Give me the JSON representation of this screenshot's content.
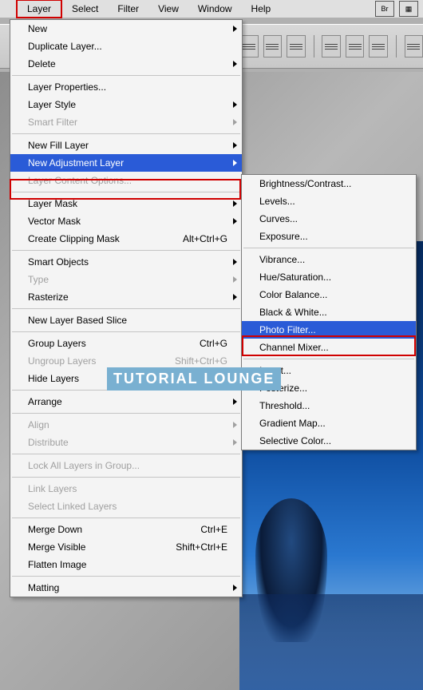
{
  "menubar": {
    "items": [
      "Layer",
      "Select",
      "Filter",
      "View",
      "Window",
      "Help"
    ]
  },
  "menu1": [
    {
      "label": "New",
      "arrow": true
    },
    {
      "label": "Duplicate Layer..."
    },
    {
      "label": "Delete",
      "arrow": true
    },
    {
      "sep": true
    },
    {
      "label": "Layer Properties..."
    },
    {
      "label": "Layer Style",
      "arrow": true
    },
    {
      "label": "Smart Filter",
      "arrow": true,
      "disabled": true
    },
    {
      "sep": true
    },
    {
      "label": "New Fill Layer",
      "arrow": true
    },
    {
      "label": "New Adjustment Layer",
      "arrow": true,
      "selected": true
    },
    {
      "label": "Layer Content Options...",
      "disabled": true
    },
    {
      "sep": true
    },
    {
      "label": "Layer Mask",
      "arrow": true
    },
    {
      "label": "Vector Mask",
      "arrow": true
    },
    {
      "label": "Create Clipping Mask",
      "shortcut": "Alt+Ctrl+G"
    },
    {
      "sep": true
    },
    {
      "label": "Smart Objects",
      "arrow": true
    },
    {
      "label": "Type",
      "arrow": true,
      "disabled": true
    },
    {
      "label": "Rasterize",
      "arrow": true
    },
    {
      "sep": true
    },
    {
      "label": "New Layer Based Slice"
    },
    {
      "sep": true
    },
    {
      "label": "Group Layers",
      "shortcut": "Ctrl+G"
    },
    {
      "label": "Ungroup Layers",
      "shortcut": "Shift+Ctrl+G",
      "disabled": true
    },
    {
      "label": "Hide Layers"
    },
    {
      "sep": true
    },
    {
      "label": "Arrange",
      "arrow": true
    },
    {
      "sep": true
    },
    {
      "label": "Align",
      "arrow": true,
      "disabled": true
    },
    {
      "label": "Distribute",
      "arrow": true,
      "disabled": true
    },
    {
      "sep": true
    },
    {
      "label": "Lock All Layers in Group...",
      "disabled": true
    },
    {
      "sep": true
    },
    {
      "label": "Link Layers",
      "disabled": true
    },
    {
      "label": "Select Linked Layers",
      "disabled": true
    },
    {
      "sep": true
    },
    {
      "label": "Merge Down",
      "shortcut": "Ctrl+E"
    },
    {
      "label": "Merge Visible",
      "shortcut": "Shift+Ctrl+E"
    },
    {
      "label": "Flatten Image"
    },
    {
      "sep": true
    },
    {
      "label": "Matting",
      "arrow": true
    }
  ],
  "menu2": [
    {
      "label": "Brightness/Contrast..."
    },
    {
      "label": "Levels..."
    },
    {
      "label": "Curves..."
    },
    {
      "label": "Exposure..."
    },
    {
      "sep": true
    },
    {
      "label": "Vibrance..."
    },
    {
      "label": "Hue/Saturation..."
    },
    {
      "label": "Color Balance..."
    },
    {
      "label": "Black & White..."
    },
    {
      "label": "Photo Filter...",
      "selected": true
    },
    {
      "label": "Channel Mixer..."
    },
    {
      "sep": true
    },
    {
      "label": "Invert..."
    },
    {
      "label": "Posterize..."
    },
    {
      "label": "Threshold..."
    },
    {
      "label": "Gradient Map..."
    },
    {
      "label": "Selective Color..."
    }
  ],
  "watermark": "TUTORIAL LOUNGE",
  "toolbar_icons": [
    "Br",
    "▦"
  ]
}
